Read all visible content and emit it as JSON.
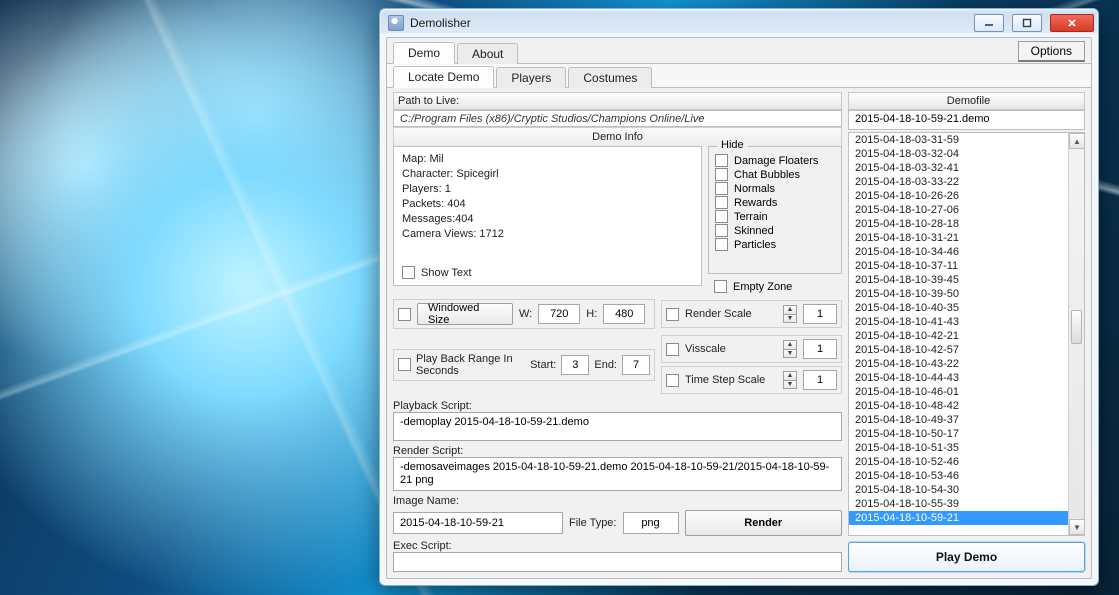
{
  "window": {
    "title": "Demolisher"
  },
  "top_tabs": {
    "demo": "Demo",
    "about": "About",
    "options": "Options"
  },
  "sub_tabs": {
    "locate": "Locate Demo",
    "players": "Players",
    "costumes": "Costumes"
  },
  "path": {
    "label": "Path to Live:",
    "value": "C:/Program Files (x86)/Cryptic Studios/Champions Online/Live"
  },
  "demofile": {
    "label": "Demofile",
    "current": "2015-04-18-10-59-21.demo"
  },
  "demo_info": {
    "title": "Demo Info",
    "map": "Map: Mil",
    "character": "Character: Spicegirl",
    "players": "Players: 1",
    "packets": "Packets: 404",
    "messages": "Messages:404",
    "camera_views": "Camera Views: 1712",
    "show_text": "Show Text"
  },
  "hide": {
    "legend": "Hide",
    "items": [
      "Damage Floaters",
      "Chat Bubbles",
      "Normals",
      "Rewards",
      "Terrain",
      "Skinned",
      "Particles"
    ],
    "empty_zone": "Empty Zone"
  },
  "window_size": {
    "button": "Windowed Size",
    "w_label": "W:",
    "w_value": "720",
    "h_label": "H:",
    "h_value": "480"
  },
  "render_scale": {
    "label": "Render Scale",
    "value": "1"
  },
  "visscale": {
    "label": "Visscale",
    "value": "1"
  },
  "timestep": {
    "label": "Time Step Scale",
    "value": "1"
  },
  "playback_range": {
    "label": "Play Back Range In Seconds",
    "start_label": "Start:",
    "start_value": "3",
    "end_label": "End:",
    "end_value": "7"
  },
  "playback_script": {
    "label": "Playback Script:",
    "value": "-demoplay 2015-04-18-10-59-21.demo"
  },
  "render_script": {
    "label": "Render Script:",
    "value": "-demosaveimages  2015-04-18-10-59-21.demo 2015-04-18-10-59-21/2015-04-18-10-59-21 png"
  },
  "image_name": {
    "label": "Image Name:",
    "value": "2015-04-18-10-59-21",
    "file_type_label": "File Type:",
    "file_type_value": "png",
    "render_button": "Render"
  },
  "exec_script": {
    "label": "Exec Script:",
    "value": ""
  },
  "file_list": [
    "2015-04-18-03-31-59",
    "2015-04-18-03-32-04",
    "2015-04-18-03-32-41",
    "2015-04-18-03-33-22",
    "2015-04-18-10-26-26",
    "2015-04-18-10-27-06",
    "2015-04-18-10-28-18",
    "2015-04-18-10-31-21",
    "2015-04-18-10-34-46",
    "2015-04-18-10-37-11",
    "2015-04-18-10-39-45",
    "2015-04-18-10-39-50",
    "2015-04-18-10-40-35",
    "2015-04-18-10-41-43",
    "2015-04-18-10-42-21",
    "2015-04-18-10-42-57",
    "2015-04-18-10-43-22",
    "2015-04-18-10-44-43",
    "2015-04-18-10-46-01",
    "2015-04-18-10-48-42",
    "2015-04-18-10-49-37",
    "2015-04-18-10-50-17",
    "2015-04-18-10-51-35",
    "2015-04-18-10-52-46",
    "2015-04-18-10-53-46",
    "2015-04-18-10-54-30",
    "2015-04-18-10-55-39",
    "2015-04-18-10-59-21"
  ],
  "file_list_selected_index": 27,
  "play_demo_button": "Play Demo"
}
